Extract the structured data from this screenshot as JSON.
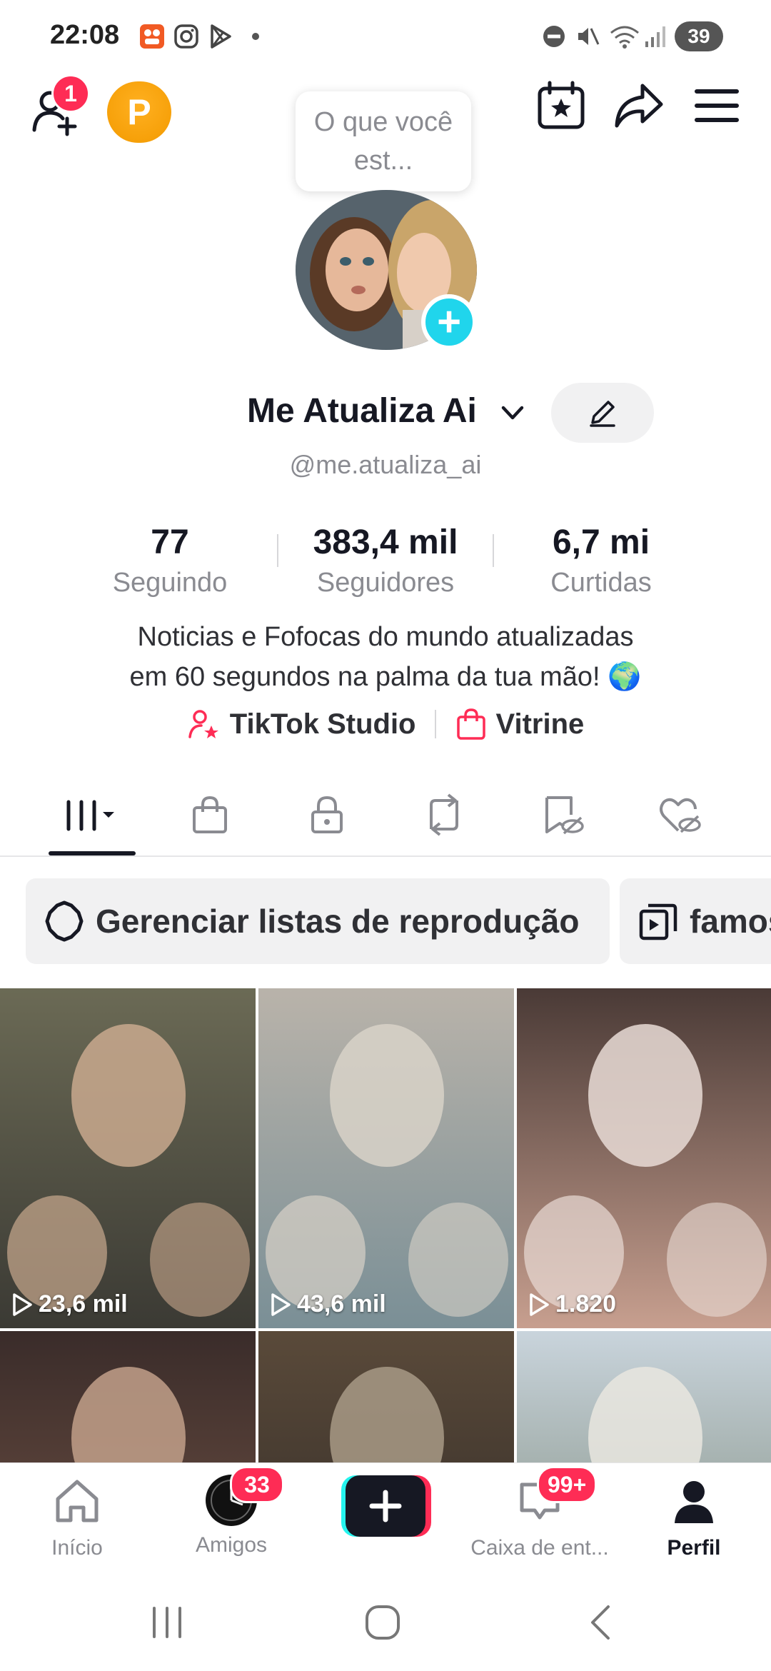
{
  "status_bar": {
    "time": "22:08",
    "battery": "39",
    "icons": [
      "app-notification-icon",
      "instagram-icon",
      "play-store-icon",
      "dot-icon",
      "do-not-disturb-icon",
      "mute-icon",
      "wifi-icon",
      "signal-icon"
    ]
  },
  "header": {
    "friend_requests_badge": "1",
    "points_letter": "P",
    "status_bubble": "O que você est..."
  },
  "profile": {
    "display_name": "Me Atualiza Ai",
    "username": "@me.atualiza_ai",
    "stats": [
      {
        "value": "77",
        "label": "Seguindo"
      },
      {
        "value": "383,4 mil",
        "label": "Seguidores"
      },
      {
        "value": "6,7 mi",
        "label": "Curtidas"
      }
    ],
    "bio_line1": "Noticias e Fofocas do mundo atualizadas",
    "bio_line2": "em 60 segundos na palma da tua mão! 🌍",
    "links": {
      "studio": "TikTok Studio",
      "showcase": "Vitrine"
    }
  },
  "tabs": [
    "videos",
    "shop",
    "private",
    "reposts",
    "favorites",
    "liked"
  ],
  "playlists": {
    "manage": "Gerenciar listas de reprodução",
    "playlist_1": "famosos"
  },
  "videos": [
    {
      "views": "23,6 mil",
      "colors": [
        "#6b6a55",
        "#3b3a34",
        "#c9a98e"
      ]
    },
    {
      "views": "43,6 mil",
      "colors": [
        "#b9b3aa",
        "#7a8f96",
        "#d8d2c8"
      ]
    },
    {
      "views": "1.820",
      "colors": [
        "#4a3a36",
        "#c79f8f",
        "#e9dcd6"
      ]
    },
    {
      "views": "",
      "colors": [
        "#3a2c2a",
        "#7c5a4a",
        "#c2a08a"
      ]
    },
    {
      "views": "",
      "colors": [
        "#5a4a3a",
        "#2b2623",
        "#a89a86"
      ]
    },
    {
      "views": "",
      "colors": [
        "#c9d4dc",
        "#6f7c6a",
        "#e9e6df"
      ]
    }
  ],
  "bottom_nav": {
    "home": "Início",
    "friends": "Amigos",
    "friends_badge": "33",
    "inbox": "Caixa de ent...",
    "inbox_badge": "99+",
    "profile": "Perfil"
  },
  "colors": {
    "accent": "#fe2c55",
    "teal": "#20d5ec",
    "text": "#161823",
    "muted": "#8a8b91"
  }
}
